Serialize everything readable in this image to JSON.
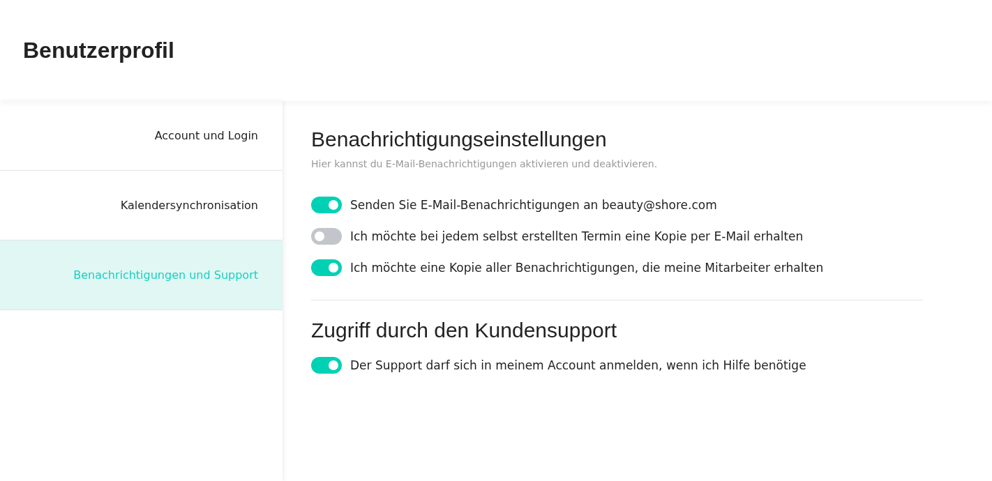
{
  "header": {
    "title": "Benutzerprofil"
  },
  "sidebar": {
    "items": [
      {
        "label": "Account und Login",
        "selected": false
      },
      {
        "label": "Kalendersynchronisation",
        "selected": false
      },
      {
        "label": "Benachrichtigungen und Support",
        "selected": true
      }
    ]
  },
  "sections": [
    {
      "title": "Benachrichtigungseinstellungen",
      "description": "Hier kannst du E-Mail-Benachrichtigungen aktivieren und deaktivieren.",
      "toggles": [
        {
          "label": "Senden Sie E-Mail-Benachrichtigungen an beauty@shore.com",
          "on": true
        },
        {
          "label": "Ich möchte bei jedem selbst erstellten Termin eine Kopie per E-Mail erhalten",
          "on": false
        },
        {
          "label": "Ich möchte eine Kopie aller Benachrichtigungen, die meine Mitarbeiter erhalten",
          "on": true
        }
      ]
    },
    {
      "title": "Zugriff durch den Kundensupport",
      "toggles": [
        {
          "label": "Der Support darf sich in meinem Account anmelden, wenn ich Hilfe benötige",
          "on": true
        }
      ]
    }
  ]
}
